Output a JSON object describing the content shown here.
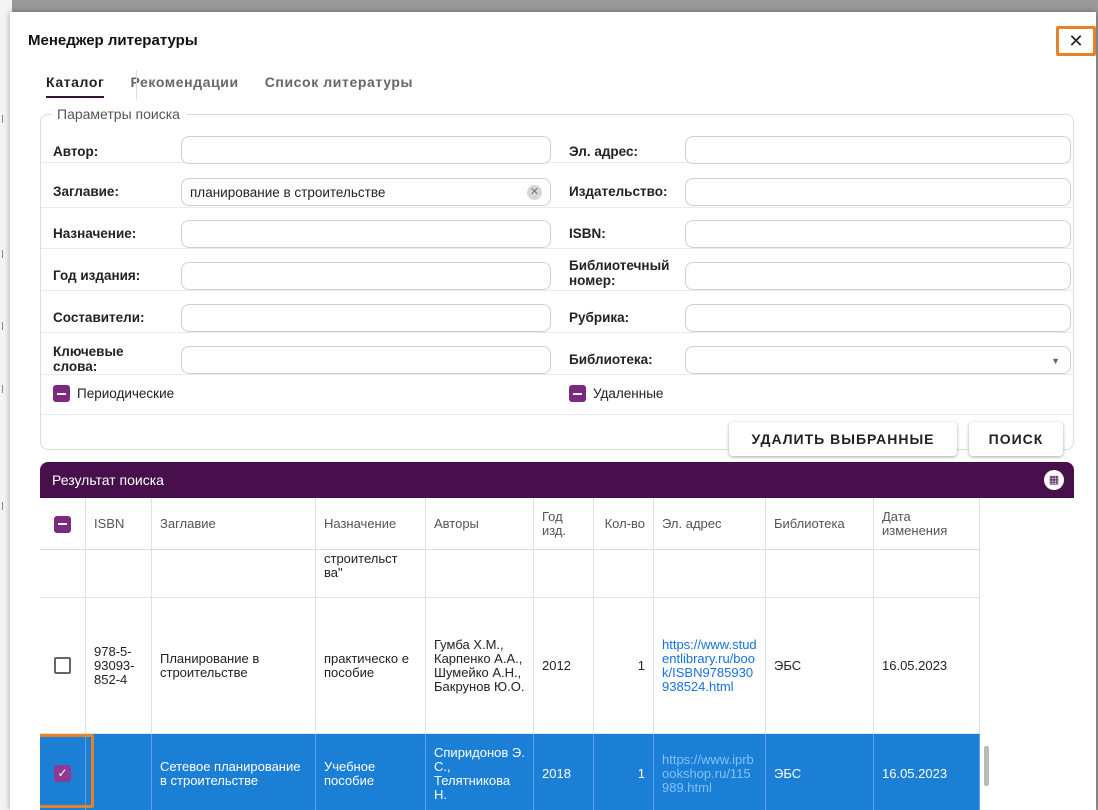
{
  "dialog": {
    "title": "Менеджер литературы",
    "close_label": "✕"
  },
  "tabs": [
    {
      "label": "Каталог",
      "active": true
    },
    {
      "label": "Рекомендации",
      "active": false
    },
    {
      "label": "Список литературы",
      "active": false
    }
  ],
  "search": {
    "legend": "Параметры поиска",
    "author_label": "Автор:",
    "author_value": "",
    "email_label": "Эл. адрес:",
    "email_value": "",
    "title_label": "Заглавие:",
    "title_value": "планирование в строительстве",
    "publisher_label": "Издательство:",
    "publisher_value": "",
    "purpose_label": "Назначение:",
    "purpose_value": "",
    "isbn_label": "ISBN:",
    "isbn_value": "",
    "year_label": "Год издания:",
    "year_value": "",
    "library_number_label": "Библиотечный номер:",
    "library_number_value": "",
    "compilers_label": "Составители:",
    "compilers_value": "",
    "rubric_label": "Рубрика:",
    "rubric_value": "",
    "keywords_label": "Ключевые слова:",
    "keywords_value": "",
    "library_label": "Библиотека:",
    "library_value": "",
    "periodic_label": "Периодические",
    "deleted_label": "Удаленные",
    "delete_selected_button": "УДАЛИТЬ ВЫБРАННЫЕ",
    "search_button": "ПОИСК"
  },
  "results": {
    "title": "Результат поиска",
    "columns": [
      "ISBN",
      "Заглавие",
      "Назначение",
      "Авторы",
      "Год изд.",
      "Кол-во",
      "Эл. адрес",
      "Библиотека",
      "Дата изменения"
    ],
    "rows": [
      {
        "checked": false,
        "isbn": "",
        "title": "",
        "purpose": "строительст ва\"",
        "authors": "",
        "year": "",
        "count": "",
        "url": "",
        "library": "",
        "date": ""
      },
      {
        "checked": false,
        "isbn": "978-5-93093-852-4",
        "title": "Планирование в строительстве",
        "purpose": "практическо е пособие",
        "authors": "Гумба Х.М., Карпенко А.А., Шумейко А.Н., Бакрунов Ю.О.",
        "year": "2012",
        "count": "1",
        "url": "https://www.studentlibrary.ru/book/ISBN9785930938524.html",
        "library": "ЭБС",
        "date": "16.05.2023"
      },
      {
        "checked": true,
        "isbn": "",
        "title": "Сетевое планирование в строительстве",
        "purpose": "Учебное пособие",
        "authors": "Спиридонов Э. С., Телятникова Н.",
        "year": "2018",
        "count": "1",
        "url": "https://www.iprbookshop.ru/115989.html",
        "library": "ЭБС",
        "date": "16.05.2023"
      }
    ]
  }
}
